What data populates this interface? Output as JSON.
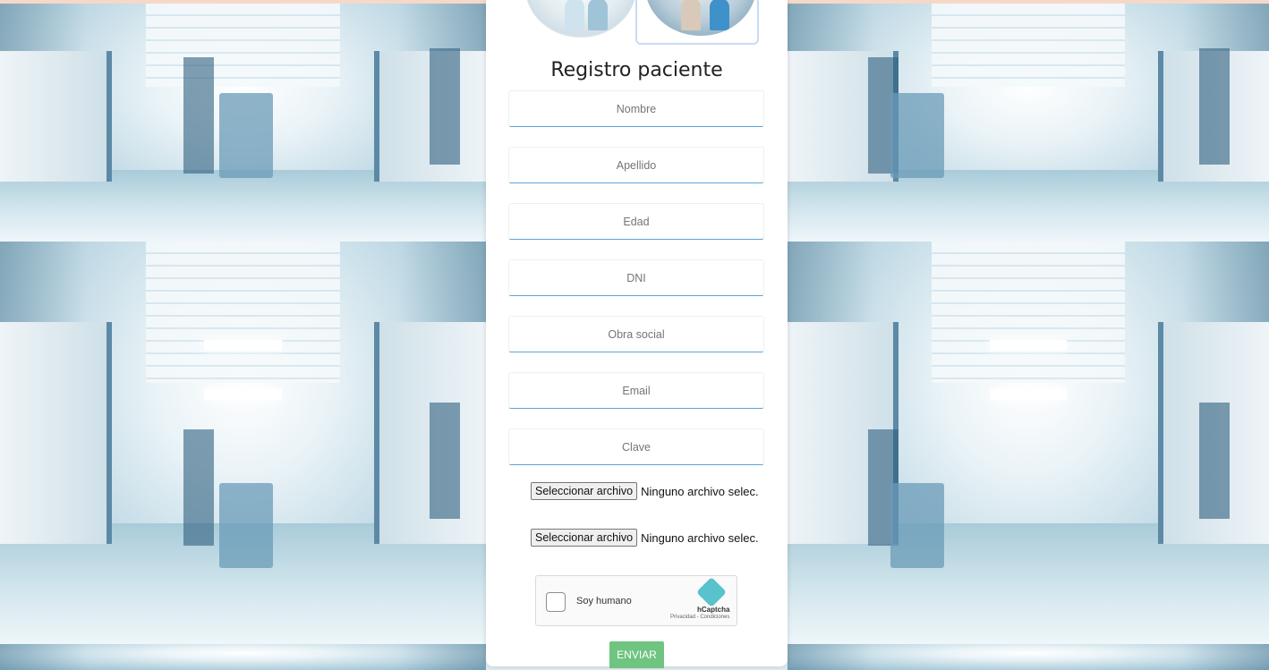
{
  "form": {
    "title": "Registro paciente",
    "fields": [
      {
        "placeholder": "Nombre"
      },
      {
        "placeholder": "Apellido"
      },
      {
        "placeholder": "Edad"
      },
      {
        "placeholder": "DNI"
      },
      {
        "placeholder": "Obra social"
      },
      {
        "placeholder": "Email"
      },
      {
        "placeholder": "Clave"
      }
    ],
    "file_inputs": [
      {
        "button": "Seleccionar archivo",
        "status": "Ninguno archivo selec."
      },
      {
        "button": "Seleccionar archivo",
        "status": "Ninguno archivo selec."
      }
    ],
    "captcha": {
      "label": "Soy humano",
      "brand": "hCaptcha",
      "terms": "Privacidad - Condiciones"
    },
    "submit_label": "ENVIAR"
  },
  "colors": {
    "accent_underline": "#5ca4d2",
    "submit_button": "#6ec480",
    "top_bar": "#f6d8c8"
  }
}
